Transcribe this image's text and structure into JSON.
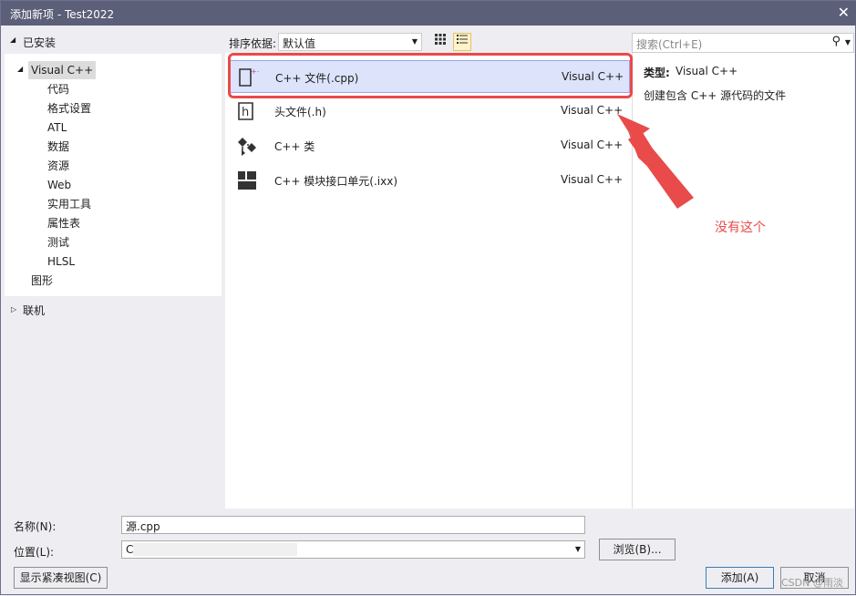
{
  "window": {
    "title": "添加新项 - Test2022",
    "close_glyph": "✕"
  },
  "left": {
    "installed_label": "已安装",
    "tree": {
      "root": "Visual C++",
      "children": [
        "代码",
        "格式设置",
        "ATL",
        "数据",
        "资源",
        "Web",
        "实用工具",
        "属性表",
        "测试",
        "HLSL"
      ],
      "graphics": "图形"
    },
    "online_label": "联机"
  },
  "toolbar": {
    "sort_label": "排序依据:",
    "sort_value": "默认值"
  },
  "templates": [
    {
      "name": "C++ 文件(.cpp)",
      "lang": "Visual C++",
      "icon": "cpp-file-icon"
    },
    {
      "name": "头文件(.h)",
      "lang": "Visual C++",
      "icon": "header-file-icon"
    },
    {
      "name": "C++ 类",
      "lang": "Visual C++",
      "icon": "cpp-class-icon"
    },
    {
      "name": "C++ 模块接口单元(.ixx)",
      "lang": "Visual C++",
      "icon": "module-interface-icon"
    }
  ],
  "search": {
    "placeholder": "搜索(Ctrl+E)"
  },
  "details": {
    "type_label": "类型:",
    "type_value": "Visual C++",
    "description": "创建包含 C++ 源代码的文件"
  },
  "annotation": {
    "text": "没有这个",
    "color": "#e94a4a"
  },
  "form": {
    "name_label": "名称(N):",
    "name_value": "源.cpp",
    "location_label": "位置(L):",
    "location_value": "C",
    "browse_label": "浏览(B)...",
    "compact_view_label": "显示紧凑视图(C)",
    "add_label": "添加(A)",
    "cancel_label": "取消"
  },
  "watermark": "CSDN @雨淡",
  "colors": {
    "titlebar": "#5c5f78",
    "selection": "#dce3fb",
    "accent_red": "#e94a4a"
  }
}
